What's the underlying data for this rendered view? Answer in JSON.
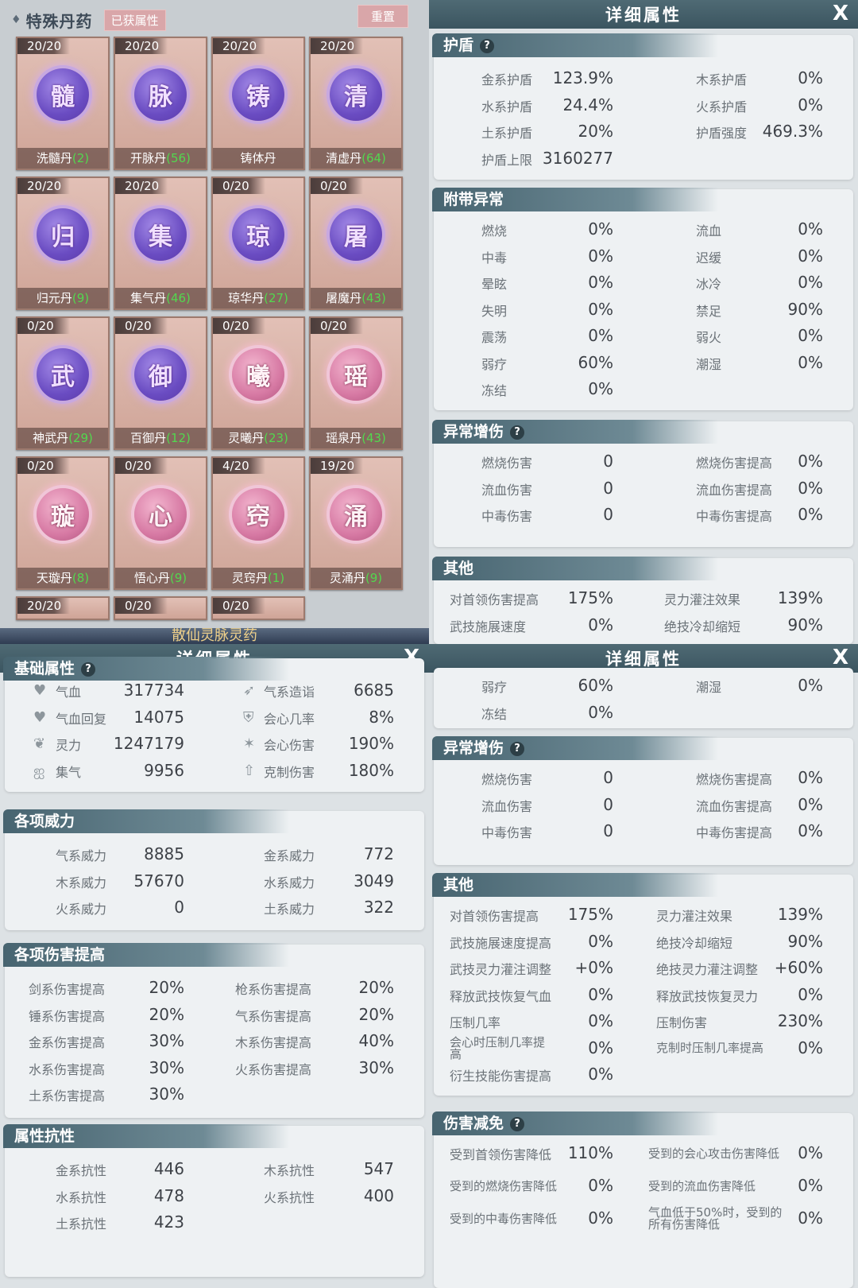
{
  "pill_panel": {
    "diamond": "♦",
    "title": "特殊丹药",
    "badge": "已获属性",
    "reset": "重置",
    "bottom_text": "散仙灵脉灵药",
    "pills": [
      {
        "count": "20/20",
        "glyph": "髓",
        "name": "洗髓丹",
        "num": "(2)",
        "color": "purple"
      },
      {
        "count": "20/20",
        "glyph": "脉",
        "name": "开脉丹",
        "num": "(56)",
        "color": "purple"
      },
      {
        "count": "20/20",
        "glyph": "铸",
        "name": "铸体丹",
        "num": "",
        "color": "purple"
      },
      {
        "count": "20/20",
        "glyph": "清",
        "name": "清虚丹",
        "num": "(64)",
        "color": "purple"
      },
      {
        "count": "20/20",
        "glyph": "归",
        "name": "归元丹",
        "num": "(9)",
        "color": "purple"
      },
      {
        "count": "20/20",
        "glyph": "集",
        "name": "集气丹",
        "num": "(46)",
        "color": "purple"
      },
      {
        "count": "0/20",
        "glyph": "琼",
        "name": "琼华丹",
        "num": "(27)",
        "color": "purple"
      },
      {
        "count": "0/20",
        "glyph": "屠",
        "name": "屠魔丹",
        "num": "(43)",
        "color": "purple"
      },
      {
        "count": "0/20",
        "glyph": "武",
        "name": "神武丹",
        "num": "(29)",
        "color": "purple"
      },
      {
        "count": "0/20",
        "glyph": "御",
        "name": "百御丹",
        "num": "(12)",
        "color": "purple"
      },
      {
        "count": "0/20",
        "glyph": "曦",
        "name": "灵曦丹",
        "num": "(23)",
        "color": "pink"
      },
      {
        "count": "0/20",
        "glyph": "瑶",
        "name": "瑶泉丹",
        "num": "(43)",
        "color": "pink"
      },
      {
        "count": "0/20",
        "glyph": "璇",
        "name": "天璇丹",
        "num": "(8)",
        "color": "pink"
      },
      {
        "count": "0/20",
        "glyph": "心",
        "name": "悟心丹",
        "num": "(9)",
        "color": "pink"
      },
      {
        "count": "4/20",
        "glyph": "窍",
        "name": "灵窍丹",
        "num": "(1)",
        "color": "pink"
      },
      {
        "count": "19/20",
        "glyph": "涌",
        "name": "灵涌丹",
        "num": "(9)",
        "color": "pink"
      },
      {
        "count": "20/20"
      },
      {
        "count": "0/20"
      },
      {
        "count": "0/20"
      }
    ]
  },
  "detail_title": "详细属性",
  "close": "X",
  "p2": {
    "shield": {
      "title": "护盾",
      "qm": "?",
      "rows": [
        [
          "金系护盾",
          "123.9%",
          "木系护盾",
          "0%"
        ],
        [
          "水系护盾",
          "24.4%",
          "火系护盾",
          "0%"
        ],
        [
          "土系护盾",
          "20%",
          "护盾强度",
          "469.3%"
        ],
        [
          "护盾上限",
          "3160277",
          "",
          ""
        ]
      ]
    },
    "status": {
      "title": "附带异常",
      "rows": [
        [
          "燃烧",
          "0%",
          "流血",
          "0%"
        ],
        [
          "中毒",
          "0%",
          "迟缓",
          "0%"
        ],
        [
          "晕眩",
          "0%",
          "冰冷",
          "0%"
        ],
        [
          "失明",
          "0%",
          "禁足",
          "90%"
        ],
        [
          "震荡",
          "0%",
          "弱火",
          "0%"
        ],
        [
          "弱疗",
          "60%",
          "潮湿",
          "0%"
        ],
        [
          "冻结",
          "0%",
          "",
          ""
        ]
      ]
    },
    "abn": {
      "title": "异常增伤",
      "qm": "?",
      "rows": [
        [
          "燃烧伤害",
          "0",
          "燃烧伤害提高",
          "0%"
        ],
        [
          "流血伤害",
          "0",
          "流血伤害提高",
          "0%"
        ],
        [
          "中毒伤害",
          "0",
          "中毒伤害提高",
          "0%"
        ]
      ]
    },
    "other": {
      "title": "其他",
      "rows": [
        [
          "对首领伤害提高",
          "175%",
          "灵力灌注效果",
          "139%"
        ],
        [
          "武技施展速度",
          "0%",
          "绝技冷却缩短",
          "90%"
        ]
      ]
    }
  },
  "p3": {
    "base": {
      "title": "基础属性",
      "qm": "?",
      "rows": [
        [
          "气血",
          "317734",
          "气系造诣",
          "6685"
        ],
        [
          "气血回复",
          "14075",
          "会心几率",
          "8%"
        ],
        [
          "灵力",
          "1247179",
          "会心伤害",
          "190%"
        ],
        [
          "集气",
          "9956",
          "克制伤害",
          "180%"
        ]
      ],
      "icons": [
        "heart-icon",
        "heart-regen-icon",
        "flame-icon",
        "swirl-icon",
        "wind-icon",
        "crit-shield-icon",
        "burst-icon",
        "arrow-up-icon"
      ]
    },
    "power": {
      "title": "各项威力",
      "rows": [
        [
          "气系威力",
          "8885",
          "金系威力",
          "772"
        ],
        [
          "木系威力",
          "57670",
          "水系威力",
          "3049"
        ],
        [
          "火系威力",
          "0",
          "土系威力",
          "322"
        ]
      ]
    },
    "dmg": {
      "title": "各项伤害提高",
      "rows": [
        [
          "剑系伤害提高",
          "20%",
          "枪系伤害提高",
          "20%"
        ],
        [
          "锤系伤害提高",
          "20%",
          "气系伤害提高",
          "20%"
        ],
        [
          "金系伤害提高",
          "30%",
          "木系伤害提高",
          "40%"
        ],
        [
          "水系伤害提高",
          "30%",
          "火系伤害提高",
          "30%"
        ],
        [
          "土系伤害提高",
          "30%",
          "",
          ""
        ]
      ]
    },
    "res": {
      "title": "属性抗性",
      "rows": [
        [
          "金系抗性",
          "446",
          "木系抗性",
          "547"
        ],
        [
          "水系抗性",
          "478",
          "火系抗性",
          "400"
        ],
        [
          "土系抗性",
          "423",
          "",
          ""
        ]
      ]
    }
  },
  "p4": {
    "status_tail": {
      "rows": [
        [
          "弱疗",
          "60%",
          "潮湿",
          "0%"
        ],
        [
          "冻结",
          "0%",
          "",
          ""
        ]
      ]
    },
    "abn": {
      "title": "异常增伤",
      "qm": "?",
      "rows": [
        [
          "燃烧伤害",
          "0",
          "燃烧伤害提高",
          "0%"
        ],
        [
          "流血伤害",
          "0",
          "流血伤害提高",
          "0%"
        ],
        [
          "中毒伤害",
          "0",
          "中毒伤害提高",
          "0%"
        ]
      ]
    },
    "other": {
      "title": "其他",
      "rows": [
        [
          "对首领伤害提高",
          "175%",
          "灵力灌注效果",
          "139%"
        ],
        [
          "武技施展速度提高",
          "0%",
          "绝技冷却缩短",
          "90%"
        ],
        [
          "武技灵力灌注调整",
          "+0%",
          "绝技灵力灌注调整",
          "+60%"
        ],
        [
          "释放武技恢复气血",
          "0%",
          "释放武技恢复灵力",
          "0%"
        ],
        [
          "压制几率",
          "0%",
          "压制伤害",
          "230%"
        ],
        [
          "会心时压制几率提高",
          "0%",
          "克制时压制几率提高",
          "0%"
        ],
        [
          "衍生技能伤害提高",
          "0%",
          "",
          ""
        ]
      ]
    },
    "reduce": {
      "title": "伤害减免",
      "qm": "?",
      "rows": [
        [
          "受到首领伤害降低",
          "110%",
          "受到的会心攻击伤害降低",
          "0%"
        ],
        [
          "受到的燃烧伤害降低",
          "0%",
          "受到的流血伤害降低",
          "0%"
        ],
        [
          "受到的中毒伤害降低",
          "0%",
          "气血低于50%时，受到的所有伤害降低",
          "0%"
        ]
      ]
    }
  }
}
